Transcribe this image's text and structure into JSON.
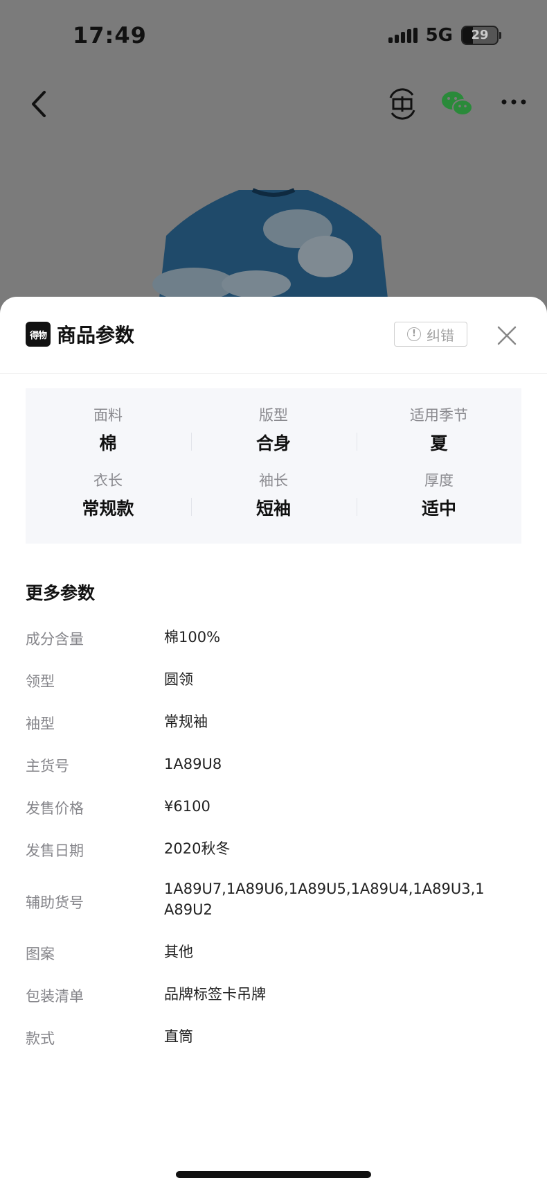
{
  "status_bar": {
    "time": "17:49",
    "network": "5G",
    "battery": "29",
    "battery_level": 0.29
  },
  "sheet": {
    "brand_logo": "得物",
    "title": "商品参数",
    "report_label": "纠错"
  },
  "params": [
    {
      "label": "面料",
      "value": "棉"
    },
    {
      "label": "版型",
      "value": "合身"
    },
    {
      "label": "适用季节",
      "value": "夏"
    },
    {
      "label": "衣长",
      "value": "常规款"
    },
    {
      "label": "袖长",
      "value": "短袖"
    },
    {
      "label": "厚度",
      "value": "适中"
    }
  ],
  "more": {
    "title": "更多参数",
    "rows": [
      {
        "label": "成分含量",
        "value": "棉100%"
      },
      {
        "label": "领型",
        "value": "圆领"
      },
      {
        "label": "袖型",
        "value": "常规袖"
      },
      {
        "label": "主货号",
        "value": "1A89U8"
      },
      {
        "label": "发售价格",
        "value": "¥6100"
      },
      {
        "label": "发售日期",
        "value": "2020秋冬"
      },
      {
        "label": "辅助货号",
        "value": "1A89U7,1A89U6,1A89U5,1A89U4,1A89U3,1A89U2"
      },
      {
        "label": "图案",
        "value": "其他"
      },
      {
        "label": "包装清单",
        "value": "品牌标签卡吊牌"
      },
      {
        "label": "款式",
        "value": "直筒"
      }
    ]
  }
}
